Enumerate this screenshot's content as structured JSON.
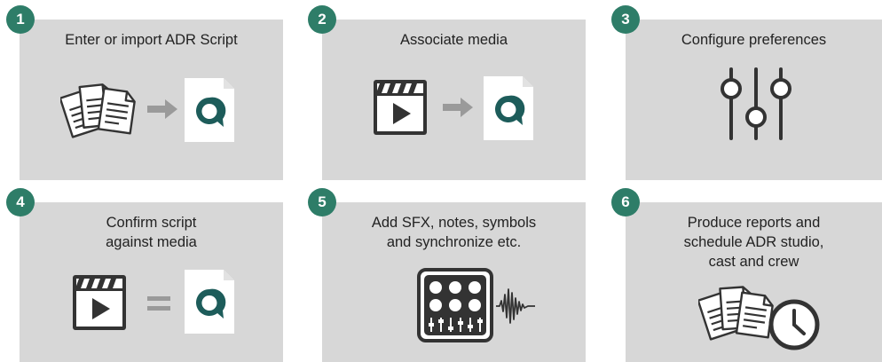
{
  "accent_color": "#2e7d68",
  "card_color": "#d7d7d7",
  "steps": [
    {
      "number": "1",
      "title": "Enter or import ADR Script",
      "icons": [
        "documents-icon",
        "arrow-right-icon",
        "app-logo-file-icon"
      ]
    },
    {
      "number": "2",
      "title": "Associate media",
      "icons": [
        "video-clapper-icon",
        "arrow-right-icon",
        "app-logo-file-icon"
      ]
    },
    {
      "number": "3",
      "title": "Configure preferences",
      "icons": [
        "sliders-icon"
      ]
    },
    {
      "number": "4",
      "title": "Confirm script\nagainst media",
      "icons": [
        "video-clapper-icon",
        "equals-icon",
        "app-logo-file-icon"
      ]
    },
    {
      "number": "5",
      "title": "Add SFX, notes, symbols\nand synchronize etc.",
      "icons": [
        "sound-mixer-icon",
        "waveform-icon"
      ]
    },
    {
      "number": "6",
      "title": "Produce reports and\nschedule ADR studio,\ncast and crew",
      "icons": [
        "documents-icon",
        "clock-icon"
      ]
    }
  ]
}
